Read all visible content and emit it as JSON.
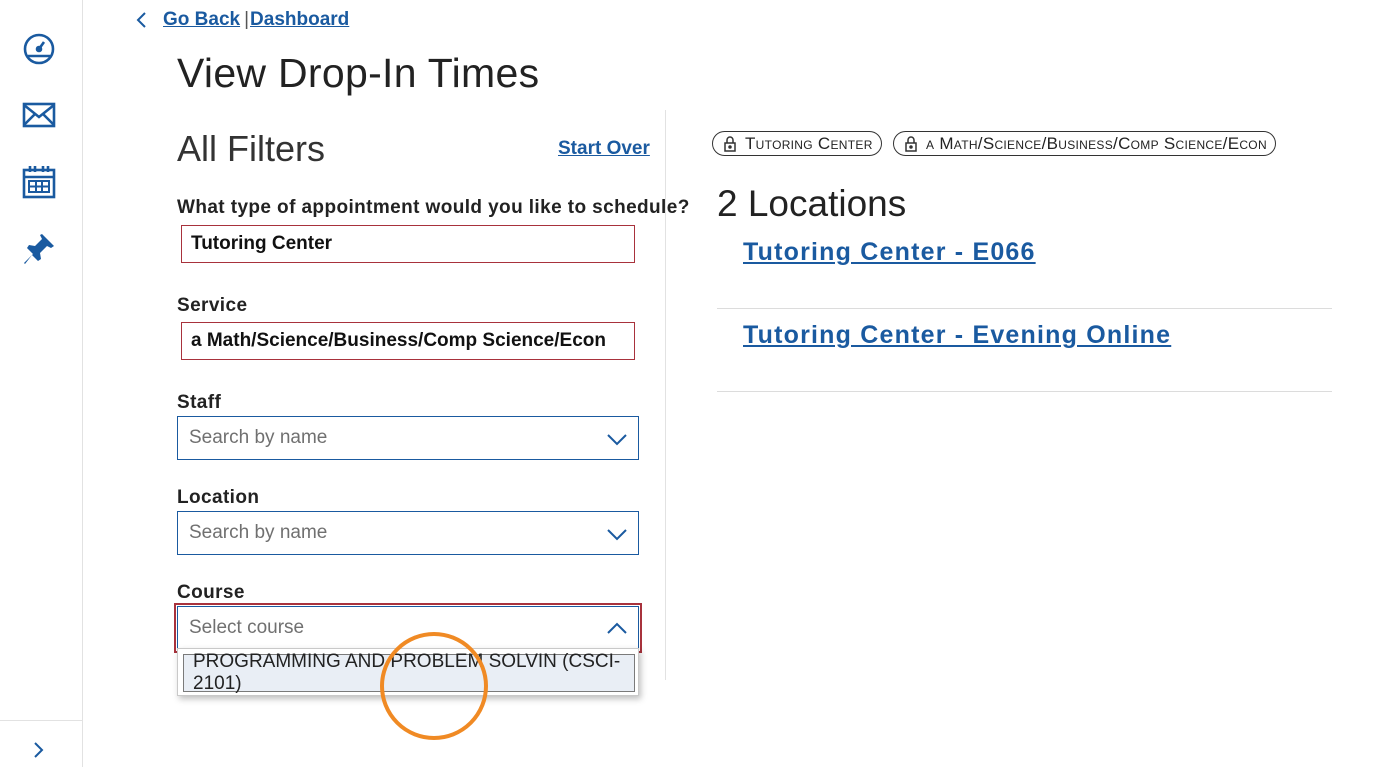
{
  "breadcrumb": {
    "back_label": "Go Back",
    "separator": "|",
    "dashboard_label": "Dashboard"
  },
  "page": {
    "title": "View Drop-In Times"
  },
  "filters": {
    "heading": "All Filters",
    "start_over": "Start Over",
    "appointment": {
      "label": "What type of appointment would you like to schedule?",
      "value": "Tutoring Center"
    },
    "service": {
      "label": "Service",
      "value": "a Math/Science/Business/Comp Science/Econ"
    },
    "staff": {
      "label": "Staff",
      "placeholder": "Search by name"
    },
    "location": {
      "label": "Location",
      "placeholder": "Search by name"
    },
    "course": {
      "label": "Course",
      "placeholder": "Select course",
      "options": [
        "PROGRAMMING AND PROBLEM SOLVIN (CSCI-2101)"
      ]
    }
  },
  "results": {
    "chips": [
      "Tutoring Center",
      "a Math/Science/Business/Comp Science/Econ"
    ],
    "count_label": "2 Locations",
    "locations": [
      "Tutoring Center - E066",
      "Tutoring Center - Evening Online"
    ]
  },
  "icons": {
    "rail": [
      "dashboard-gauge-icon",
      "envelope-icon",
      "calendar-icon",
      "pushpin-icon"
    ],
    "rail_expand": "chevron-right-icon"
  },
  "colors": {
    "link": "#1a5aa0",
    "rail_icon": "#1a5aa0",
    "error_border": "#a8323c",
    "click_ring": "#f08a24"
  }
}
